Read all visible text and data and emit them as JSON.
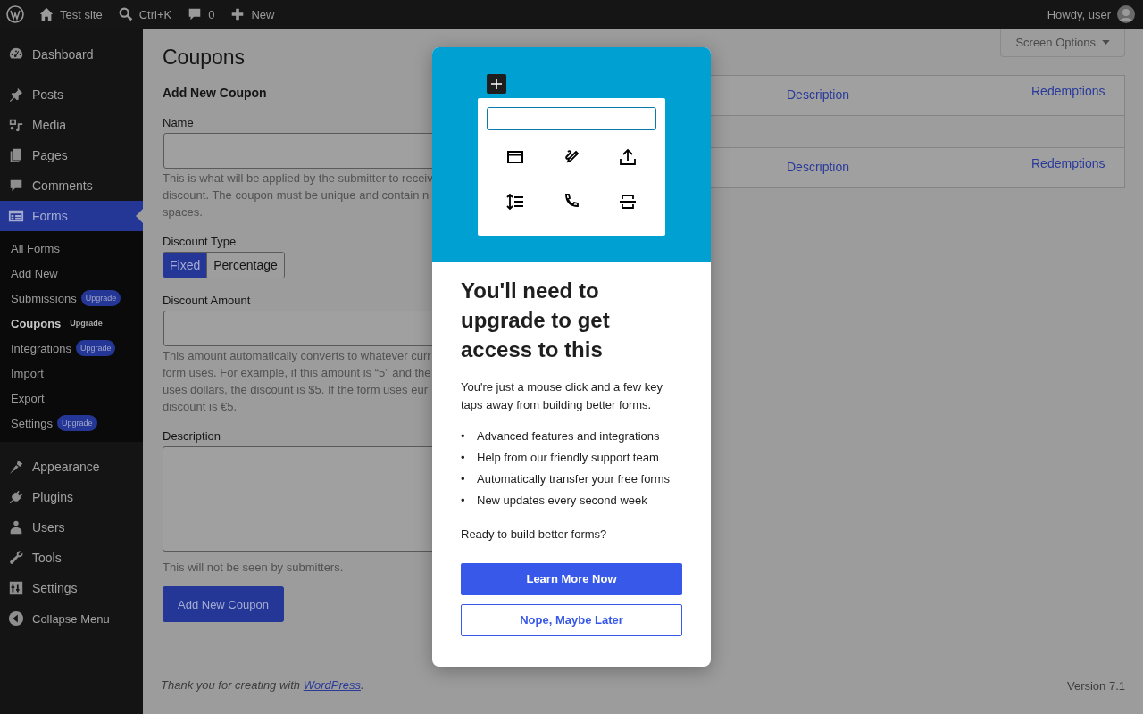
{
  "admin_bar": {
    "site": "Test site",
    "search": "Ctrl+K",
    "comments": "0",
    "new": "New",
    "greeting": "Howdy, user"
  },
  "sidebar": {
    "items": [
      {
        "label": "Dashboard",
        "selected": false
      },
      {
        "label": "Posts",
        "selected": false
      },
      {
        "label": "Media",
        "selected": false
      },
      {
        "label": "Pages",
        "selected": false
      },
      {
        "label": "Comments",
        "selected": false
      },
      {
        "label": "Forms",
        "selected": true
      }
    ],
    "submenu": [
      {
        "label": "All Forms",
        "selected": false
      },
      {
        "label": "Add New",
        "selected": false
      },
      {
        "label": "Submissions",
        "selected": false,
        "badge": "Upgrade"
      },
      {
        "label": "Coupons",
        "selected": true,
        "badge": "Upgrade"
      },
      {
        "label": "Integrations",
        "selected": false,
        "badge": "Upgrade"
      },
      {
        "label": "Import",
        "selected": false
      },
      {
        "label": "Export",
        "selected": false
      },
      {
        "label": "Settings",
        "selected": false,
        "badge": "Upgrade"
      }
    ],
    "items_after": [
      {
        "label": "Appearance",
        "selected": false
      },
      {
        "label": "Plugins",
        "selected": false
      },
      {
        "label": "Users",
        "selected": false
      },
      {
        "label": "Tools",
        "selected": false
      },
      {
        "label": "Settings",
        "selected": false
      }
    ],
    "collapse": "Collapse Menu"
  },
  "page": {
    "title": "Coupons",
    "screen_options": "Screen Options",
    "section": "Add New Coupon",
    "name_field": {
      "label": "Name",
      "help_lines": [
        "This is what will be applied by the submitter to receiv",
        "discount. The coupon must be unique and contain n",
        "spaces."
      ]
    },
    "discount_type": {
      "label": "Discount Type",
      "options": [
        {
          "label": "Fixed",
          "selected": true
        },
        {
          "label": "Percentage",
          "selected": false
        }
      ]
    },
    "amount_field": {
      "label": "Discount Amount",
      "help_lines": [
        "This amount automatically converts to whatever curr",
        "form uses. For example, if this amount is “5” and the",
        "uses dollars, the discount is $5. If the form uses eur",
        "discount is €5."
      ]
    },
    "description_field": {
      "label": "Description",
      "help": "This will not be seen by submitters."
    },
    "submit": "Add New Coupon",
    "table": {
      "header": [
        "Description",
        "Redemptions"
      ],
      "footer": [
        "Description",
        "Redemptions"
      ]
    }
  },
  "footer": {
    "text": "Thank you for creating with ",
    "link": "WordPress",
    "end": ".",
    "version": "Version 7.1"
  },
  "modal": {
    "title": "You'll need to upgrade to get access to this",
    "intro": "You're just a mouse click and a few key taps away from building better forms.",
    "bullet": "•",
    "features": [
      "Advanced features and integrations",
      "Help from our friendly support team",
      "Automatically transfer your free forms",
      "New updates every second week"
    ],
    "question": "Ready to build better forms?",
    "primary": "Learn More Now",
    "secondary": "Nope, Maybe Later"
  }
}
